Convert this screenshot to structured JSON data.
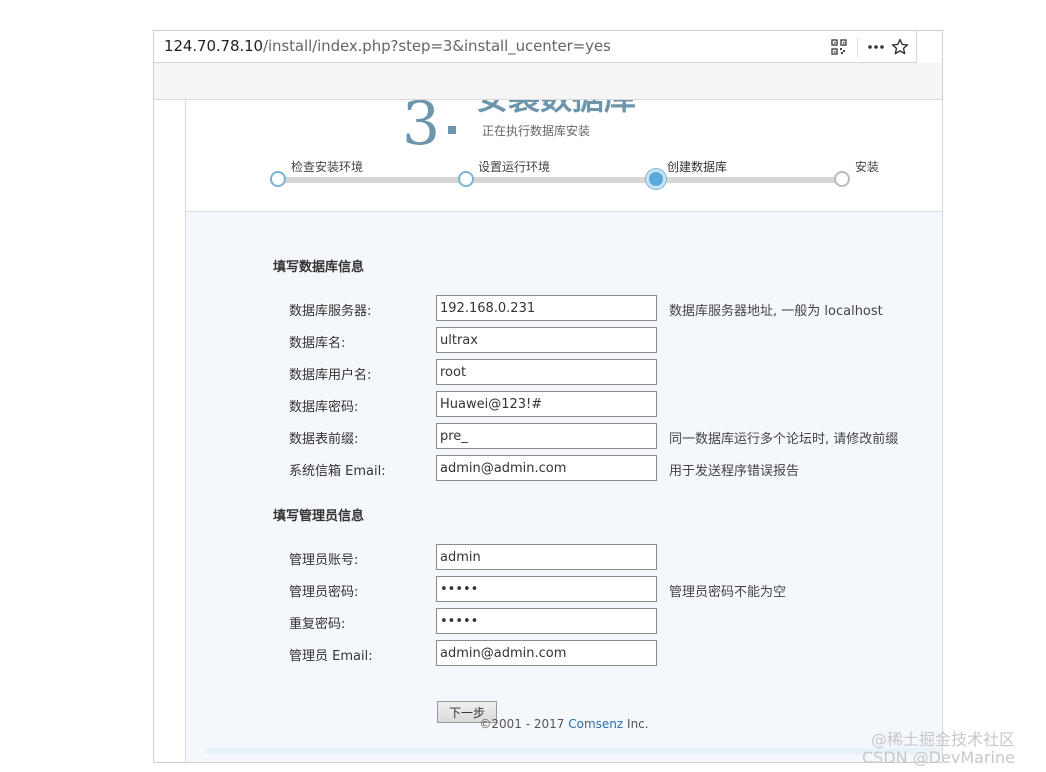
{
  "browser": {
    "url_host": "124.70.78.10",
    "url_path": "/install/index.php?step=3&install_ucenter=yes",
    "icons": [
      "qr-code-icon",
      "more-icon",
      "star-icon"
    ]
  },
  "header": {
    "step_number": "3",
    "title": "安装数据库",
    "subtitle": "正在执行数据库安装"
  },
  "steps": [
    {
      "label": "检查安装环境",
      "state": "done"
    },
    {
      "label": "设置运行环境",
      "state": "done"
    },
    {
      "label": "创建数据库",
      "state": "current"
    },
    {
      "label": "安装",
      "state": "todo"
    }
  ],
  "db_section": {
    "title": "填写数据库信息",
    "rows": [
      {
        "label": "数据库服务器:",
        "value": "192.168.0.231",
        "hint": "数据库服务器地址, 一般为 localhost"
      },
      {
        "label": "数据库名:",
        "value": "ultrax",
        "hint": ""
      },
      {
        "label": "数据库用户名:",
        "value": "root",
        "hint": ""
      },
      {
        "label": "数据库密码:",
        "value": "Huawei@123!#",
        "hint": ""
      },
      {
        "label": "数据表前缀:",
        "value": "pre_",
        "hint": "同一数据库运行多个论坛时, 请修改前缀"
      },
      {
        "label": "系统信箱 Email:",
        "value": "admin@admin.com",
        "hint": "用于发送程序错误报告"
      }
    ]
  },
  "admin_section": {
    "title": "填写管理员信息",
    "rows": [
      {
        "label": "管理员账号:",
        "value": "admin",
        "hint": ""
      },
      {
        "label": "管理员密码:",
        "value": "•••••",
        "hint": "管理员密码不能为空"
      },
      {
        "label": "重复密码:",
        "value": "•••••",
        "hint": ""
      },
      {
        "label": "管理员 Email:",
        "value": "admin@admin.com",
        "hint": ""
      }
    ]
  },
  "next_button": "下一步",
  "footer": {
    "copyright": "©2001 - 2017 ",
    "brand": "Comsenz",
    "suffix": " Inc."
  },
  "watermark": {
    "line1": "@稀土掘金技术社区",
    "line2": "CSDN @DevMarine"
  }
}
